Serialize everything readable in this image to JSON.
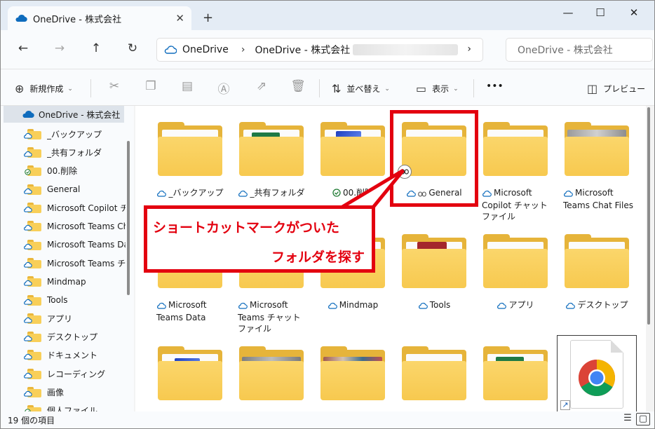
{
  "window": {
    "tab_title": "OneDrive - 株式会社",
    "new_tab": "+",
    "minimize": "—",
    "maximize": "☐",
    "close": "✕"
  },
  "nav": {
    "back": "←",
    "forward": "→",
    "up": "↑",
    "refresh": "↻",
    "address_root": "OneDrive",
    "address_sep": "›",
    "address_org": "OneDrive - 株式会社",
    "search_placeholder": "OneDrive - 株式会社"
  },
  "toolbar": {
    "new_label": "新規作成",
    "sort_label": "並べ替え",
    "view_label": "表示",
    "more_label": "•••",
    "preview_label": "プレビュー"
  },
  "sidebar": {
    "items": [
      {
        "label": "OneDrive - 株式会社",
        "icon": "cloud-icon"
      },
      {
        "label": "_バックアップ",
        "icon": "folder-cloud-icon"
      },
      {
        "label": "_共有フォルダ",
        "icon": "folder-cloud-icon"
      },
      {
        "label": "00.削除",
        "icon": "folder-synced-icon"
      },
      {
        "label": "General",
        "icon": "folder-link-icon"
      },
      {
        "label": "Microsoft Copilot チ",
        "icon": "folder-cloud-icon"
      },
      {
        "label": "Microsoft Teams Ch",
        "icon": "folder-cloud-icon"
      },
      {
        "label": "Microsoft Teams Da",
        "icon": "folder-cloud-icon"
      },
      {
        "label": "Microsoft Teams チャ",
        "icon": "folder-cloud-icon"
      },
      {
        "label": "Mindmap",
        "icon": "folder-cloud-icon"
      },
      {
        "label": "Tools",
        "icon": "folder-cloud-icon"
      },
      {
        "label": "アプリ",
        "icon": "folder-cloud-icon"
      },
      {
        "label": "デスクトップ",
        "icon": "folder-cloud-icon"
      },
      {
        "label": "ドキュメント",
        "icon": "folder-cloud-icon"
      },
      {
        "label": "レコーディング",
        "icon": "folder-cloud-icon"
      },
      {
        "label": "画像",
        "icon": "folder-cloud-icon"
      },
      {
        "label": "個人ファイル",
        "icon": "folder-synced-icon"
      }
    ]
  },
  "files": {
    "row1": [
      {
        "name": "_バックアップ",
        "status": "cloud"
      },
      {
        "name": "_共有フォルダ",
        "status": "cloud"
      },
      {
        "name": "00.削除",
        "status": "synced"
      },
      {
        "name": "General",
        "status": "cloud-link"
      },
      {
        "name": "Microsoft Copilot チャット ファイル",
        "status": "cloud"
      },
      {
        "name": "Microsoft Teams Chat Files",
        "status": "cloud"
      }
    ],
    "row2": [
      {
        "name": "Microsoft Teams Data",
        "status": "cloud"
      },
      {
        "name": "Microsoft Teams チャット ファイル",
        "status": "cloud"
      },
      {
        "name": "Mindmap",
        "status": "cloud"
      },
      {
        "name": "Tools",
        "status": "cloud"
      },
      {
        "name": "アプリ",
        "status": "cloud"
      },
      {
        "name": "デスクトップ",
        "status": "cloud"
      }
    ]
  },
  "status": {
    "item_count": "19 個の項目",
    "details_view": "☰",
    "tiles_view": "▢"
  },
  "annotation": {
    "line1": "ショートカットマークがついた",
    "line2": "フォルダを探す",
    "color": "#e3000f"
  }
}
